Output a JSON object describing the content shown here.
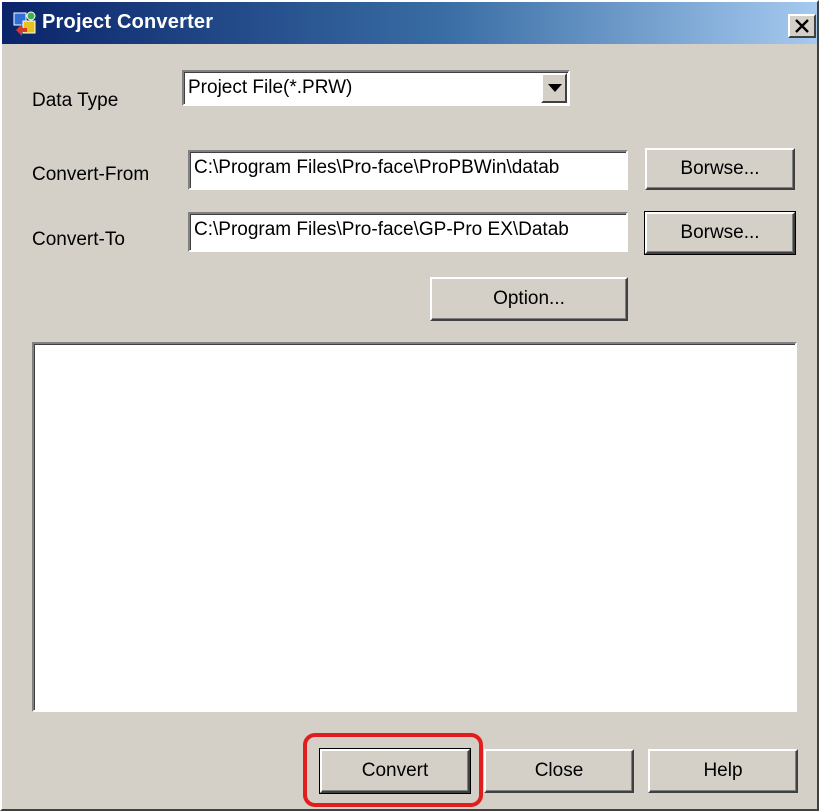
{
  "window": {
    "title": "Project Converter",
    "close_glyph": "✕"
  },
  "form": {
    "data_type_label": "Data Type",
    "data_type_value": "Project File(*.PRW)",
    "convert_from_label": "Convert-From",
    "convert_from_value": "C:\\Program Files\\Pro-face\\ProPBWin\\datab",
    "convert_to_label": "Convert-To",
    "convert_to_value": "C:\\Program Files\\Pro-face\\GP-Pro EX\\Datab",
    "browse_from_label": "Borwse...",
    "browse_to_label": "Borwse...",
    "option_label": "Option..."
  },
  "log": {
    "content": ""
  },
  "footer": {
    "convert_label": "Convert",
    "close_label": "Close",
    "help_label": "Help"
  },
  "annotation": {
    "highlight_color": "#e01e1e"
  },
  "icons": {
    "app": "project-converter-icon",
    "close": "close-icon",
    "dropdown": "chevron-down-icon"
  }
}
